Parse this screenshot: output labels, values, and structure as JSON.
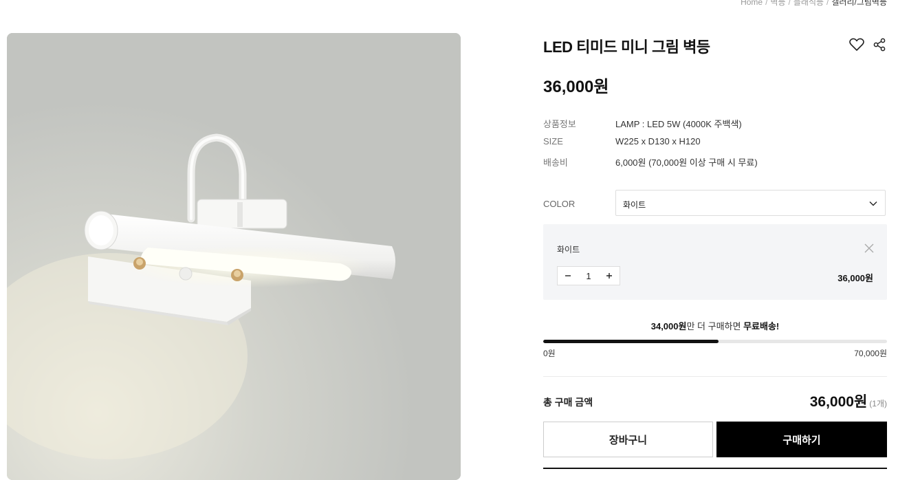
{
  "breadcrumb": [
    "Home",
    "벽등",
    "플래식등",
    "갤러리/그림벽등"
  ],
  "product": {
    "title": "LED 티미드 미니 그림 벽등",
    "price": "36,000원",
    "specs": [
      {
        "label": "상품정보",
        "value": "LAMP : LED 5W (4000K 주백색)"
      },
      {
        "label": "SIZE",
        "value": "W225 x D130 x H120"
      },
      {
        "label": "배송비",
        "value": "6,000원 (70,000원 이상 구매 시 무료)"
      }
    ]
  },
  "color_option": {
    "label": "COLOR",
    "selected": "화이트"
  },
  "selected_item": {
    "name": "화이트",
    "quantity": "1",
    "price": "36,000원"
  },
  "free_shipping": {
    "amount": "34,000원",
    "message_mid": "만 더 구매하면 ",
    "highlight": "무료배송!",
    "progress_percent": 51,
    "min_label": "0원",
    "max_label": "70,000원"
  },
  "total": {
    "label": "총 구매 금액",
    "price": "36,000원",
    "count": "(1개)"
  },
  "buttons": {
    "cart": "장바구니",
    "buy": "구매하기"
  },
  "icons": [
    "heart-icon",
    "share-icon",
    "chevron-down-icon",
    "close-icon",
    "minus-icon",
    "plus-icon"
  ],
  "colors": {
    "accent": "#000000",
    "option_bg": "#f4f5f7",
    "progress_track": "#e7e7e7"
  }
}
